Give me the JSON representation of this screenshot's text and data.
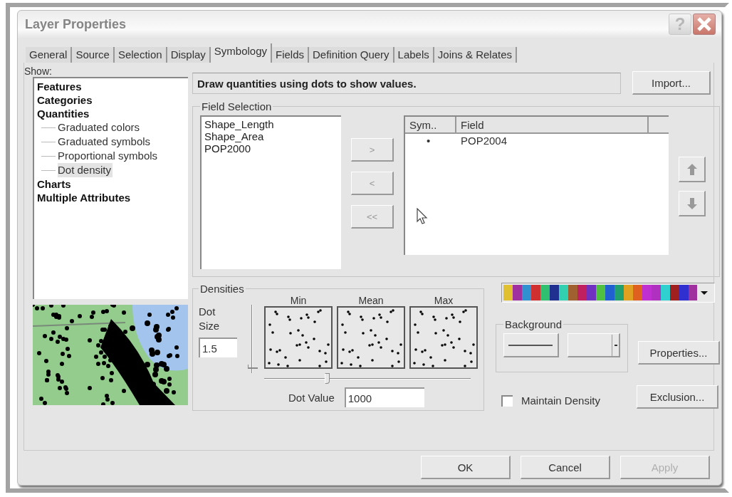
{
  "window": {
    "title": "Layer Properties",
    "help_button": "?"
  },
  "tabs": [
    {
      "label": "General",
      "selected": false
    },
    {
      "label": "Source",
      "selected": false
    },
    {
      "label": "Selection",
      "selected": false
    },
    {
      "label": "Display",
      "selected": false
    },
    {
      "label": "Symbology",
      "selected": true
    },
    {
      "label": "Fields",
      "selected": false
    },
    {
      "label": "Definition Query",
      "selected": false
    },
    {
      "label": "Labels",
      "selected": false
    },
    {
      "label": "Joins & Relates",
      "selected": false
    }
  ],
  "show": {
    "label": "Show:",
    "items": [
      {
        "label": "Features",
        "selected": false
      },
      {
        "label": "Categories",
        "selected": false
      },
      {
        "label": "Quantities",
        "selected": false,
        "children": [
          {
            "label": "Graduated colors",
            "selected": false
          },
          {
            "label": "Graduated symbols",
            "selected": false
          },
          {
            "label": "Proportional symbols",
            "selected": false
          },
          {
            "label": "Dot density",
            "selected": true
          }
        ]
      },
      {
        "label": "Charts",
        "selected": false
      },
      {
        "label": "Multiple Attributes",
        "selected": false
      }
    ]
  },
  "description": "Draw quantities using dots to show values.",
  "import_button": "Import...",
  "field_selection": {
    "title": "Field Selection",
    "available_fields": [
      "Shape_Length",
      "Shape_Area",
      "POP2000"
    ],
    "move_buttons": [
      ">",
      "<",
      "<<"
    ],
    "columns": [
      "Sym..",
      "Field"
    ],
    "rows": [
      {
        "symbol": "•",
        "field": "POP2004"
      }
    ]
  },
  "densities": {
    "title": "Densities",
    "dot_size_label": "Dot Size",
    "dot_size": "1.5",
    "dot_size_slider": {
      "level": 0.05
    },
    "previews": [
      "Min",
      "Mean",
      "Max"
    ],
    "density_slider": {
      "level": 0.3
    },
    "dot_value_label": "Dot Value",
    "dot_value": "1000"
  },
  "background": {
    "title": "Background"
  },
  "properties_button": "Properties...",
  "maintain_density": {
    "label": "Maintain Density",
    "checked": false
  },
  "exclusion_button": "Exclusion...",
  "buttons": [
    {
      "label": "OK",
      "disabled": false
    },
    {
      "label": "Cancel",
      "disabled": false
    },
    {
      "label": "Apply",
      "disabled": true
    }
  ]
}
